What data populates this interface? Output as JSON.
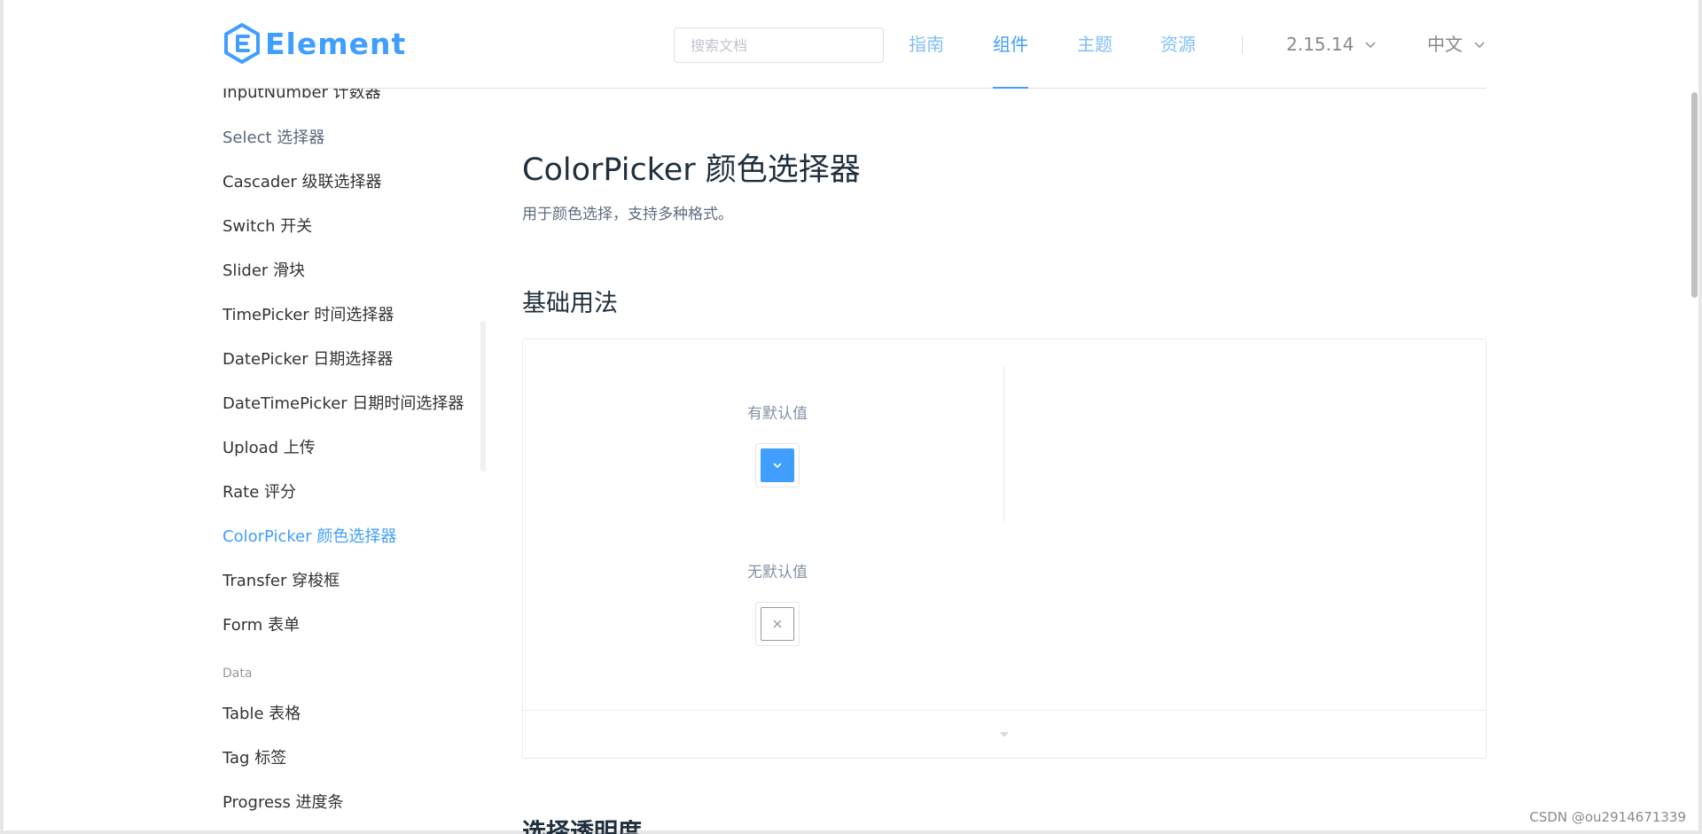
{
  "header": {
    "logo_text": "Element",
    "search_placeholder": "搜索文档",
    "nav": [
      {
        "label": "指南",
        "active": false
      },
      {
        "label": "组件",
        "active": true
      },
      {
        "label": "主题",
        "active": false
      },
      {
        "label": "资源",
        "active": false
      }
    ],
    "version": "2.15.14",
    "language": "中文"
  },
  "sidebar": {
    "items": [
      {
        "label": "InputNumber 计数器",
        "state": "normal"
      },
      {
        "label": "Select 选择器",
        "state": "hover"
      },
      {
        "label": "Cascader 级联选择器",
        "state": "normal"
      },
      {
        "label": "Switch 开关",
        "state": "normal"
      },
      {
        "label": "Slider 滑块",
        "state": "normal"
      },
      {
        "label": "TimePicker 时间选择器",
        "state": "normal"
      },
      {
        "label": "DatePicker 日期选择器",
        "state": "normal"
      },
      {
        "label": "DateTimePicker 日期时间选择器",
        "state": "normal"
      },
      {
        "label": "Upload 上传",
        "state": "normal"
      },
      {
        "label": "Rate 评分",
        "state": "normal"
      },
      {
        "label": "ColorPicker 颜色选择器",
        "state": "active"
      },
      {
        "label": "Transfer 穿梭框",
        "state": "normal"
      },
      {
        "label": "Form 表单",
        "state": "normal"
      }
    ],
    "group_label": "Data",
    "group_items": [
      {
        "label": "Table 表格"
      },
      {
        "label": "Tag 标签"
      },
      {
        "label": "Progress 进度条"
      }
    ]
  },
  "main": {
    "title": "ColorPicker 颜色选择器",
    "description": "用于颜色选择，支持多种格式。",
    "section_title": "基础用法",
    "demo": {
      "with_default_label": "有默认值",
      "without_default_label": "无默认值",
      "default_color": "#409EFF"
    },
    "next_section_title": "选择透明度"
  },
  "watermark": "CSDN @ou2914671339",
  "colors": {
    "accent": "#409eff",
    "text": "#1f2f3d",
    "muted": "#8492a6"
  }
}
